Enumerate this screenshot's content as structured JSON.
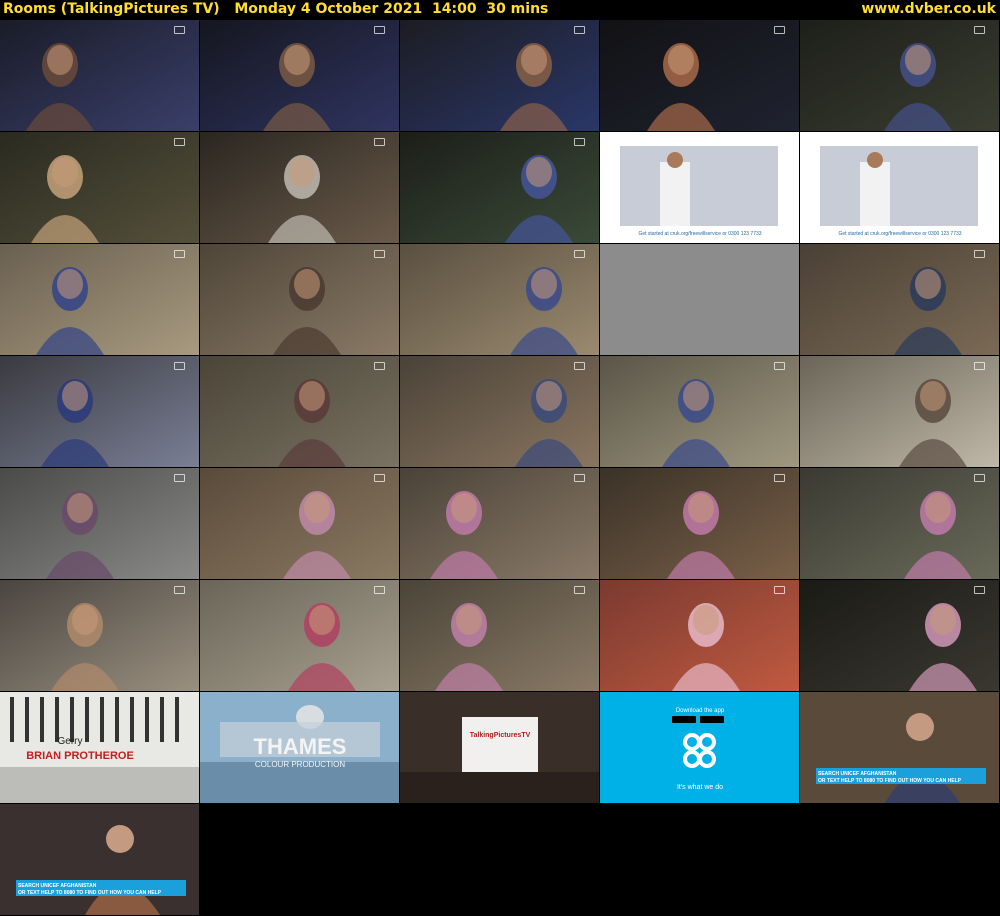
{
  "header": {
    "title": "Rooms (TalkingPictures TV)   Monday 4 October 2021  14:00  30 mins",
    "site": "www.dvber.co.uk"
  },
  "thumbnails": [
    {
      "scene": "drama",
      "palette": [
        "#1a1c28",
        "#3a3f6a",
        "#6a4a3a"
      ]
    },
    {
      "scene": "drama",
      "palette": [
        "#15161f",
        "#2f3460",
        "#7a5a44"
      ]
    },
    {
      "scene": "drama",
      "palette": [
        "#1c1c22",
        "#2a3768",
        "#8a6048"
      ]
    },
    {
      "scene": "drama",
      "palette": [
        "#121214",
        "#1f2230",
        "#a86a48"
      ]
    },
    {
      "scene": "drama",
      "palette": [
        "#1d1f1a",
        "#3a3d30",
        "#44508a"
      ]
    },
    {
      "scene": "drama",
      "palette": [
        "#2a2a20",
        "#54503a",
        "#c4a27a"
      ]
    },
    {
      "scene": "drama",
      "palette": [
        "#2a2620",
        "#6a5a4a",
        "#bfbab0"
      ]
    },
    {
      "scene": "drama",
      "palette": [
        "#1c1e18",
        "#3a4a38",
        "#44559a"
      ]
    },
    {
      "scene": "ad-cruk",
      "caption": "Get started at cruk.org/freewillservice or 0300 123 7733"
    },
    {
      "scene": "ad-cruk",
      "caption": "Get started at cruk.org/freewillservice or 0300 123 7733"
    },
    {
      "scene": "drama",
      "palette": [
        "#6a6050",
        "#a89a80",
        "#334488"
      ]
    },
    {
      "scene": "drama",
      "palette": [
        "#4e4538",
        "#8a7a66",
        "#4a3a30"
      ]
    },
    {
      "scene": "drama",
      "palette": [
        "#5a5040",
        "#9a8a70",
        "#3a4a8a"
      ]
    },
    {
      "scene": "gray"
    },
    {
      "scene": "drama",
      "palette": [
        "#4a4035",
        "#7a6a55",
        "#2a3a5a"
      ]
    },
    {
      "scene": "drama",
      "palette": [
        "#3a3a40",
        "#7a7f95",
        "#2a3a7a"
      ]
    },
    {
      "scene": "drama",
      "palette": [
        "#4a4538",
        "#7a7262",
        "#5a3a3a"
      ]
    },
    {
      "scene": "drama",
      "palette": [
        "#4a4238",
        "#8a7660",
        "#3a4a7a"
      ]
    },
    {
      "scene": "drama",
      "palette": [
        "#5a5548",
        "#a09880",
        "#3a4a8a"
      ]
    },
    {
      "scene": "drama",
      "palette": [
        "#6a6558",
        "#c0b8a8",
        "#5a4a40"
      ]
    },
    {
      "scene": "drama",
      "palette": [
        "#4a4a48",
        "#8a8a88",
        "#6a4a6a"
      ]
    },
    {
      "scene": "drama",
      "palette": [
        "#5a4a3a",
        "#8a7a62",
        "#c08aa8"
      ]
    },
    {
      "scene": "drama",
      "palette": [
        "#4a4238",
        "#8a7a68",
        "#c07aa8"
      ]
    },
    {
      "scene": "drama",
      "palette": [
        "#3a3228",
        "#7a6048",
        "#c07aa8"
      ]
    },
    {
      "scene": "drama",
      "palette": [
        "#3a3a32",
        "#6a6a5a",
        "#c07aa8"
      ]
    },
    {
      "scene": "drama",
      "palette": [
        "#4a4540",
        "#9a9080",
        "#b08a6a"
      ]
    },
    {
      "scene": "drama",
      "palette": [
        "#6a6558",
        "#a8a090",
        "#b04060"
      ]
    },
    {
      "scene": "drama",
      "palette": [
        "#4a4438",
        "#8a7a66",
        "#c080a8"
      ]
    },
    {
      "scene": "drama",
      "palette": [
        "#7a3a30",
        "#c05a40",
        "#e8b8c8"
      ]
    },
    {
      "scene": "drama",
      "palette": [
        "#1a1a16",
        "#3a3830",
        "#d098b8"
      ]
    },
    {
      "scene": "title-card",
      "text1": "Gerry",
      "text2": "BRIAN PROTHEROE"
    },
    {
      "scene": "thames",
      "text1": "THAMES",
      "text2": "COLOUR PRODUCTION"
    },
    {
      "scene": "tptv",
      "text1": "TalkingPicturesTV"
    },
    {
      "scene": "coop",
      "text1": "Download the app",
      "text2": "It's what we do"
    },
    {
      "scene": "unicef-man",
      "text1": "SEARCH UNICEF AFGHANISTAN",
      "text2": "OR TEXT HELP TO 8080 TO FIND OUT HOW YOU CAN HELP"
    },
    {
      "scene": "unicef-child",
      "text1": "SEARCH UNICEF AFGHANISTAN",
      "text2": "OR TEXT HELP TO 8080 TO FIND OUT HOW YOU CAN HELP"
    }
  ]
}
